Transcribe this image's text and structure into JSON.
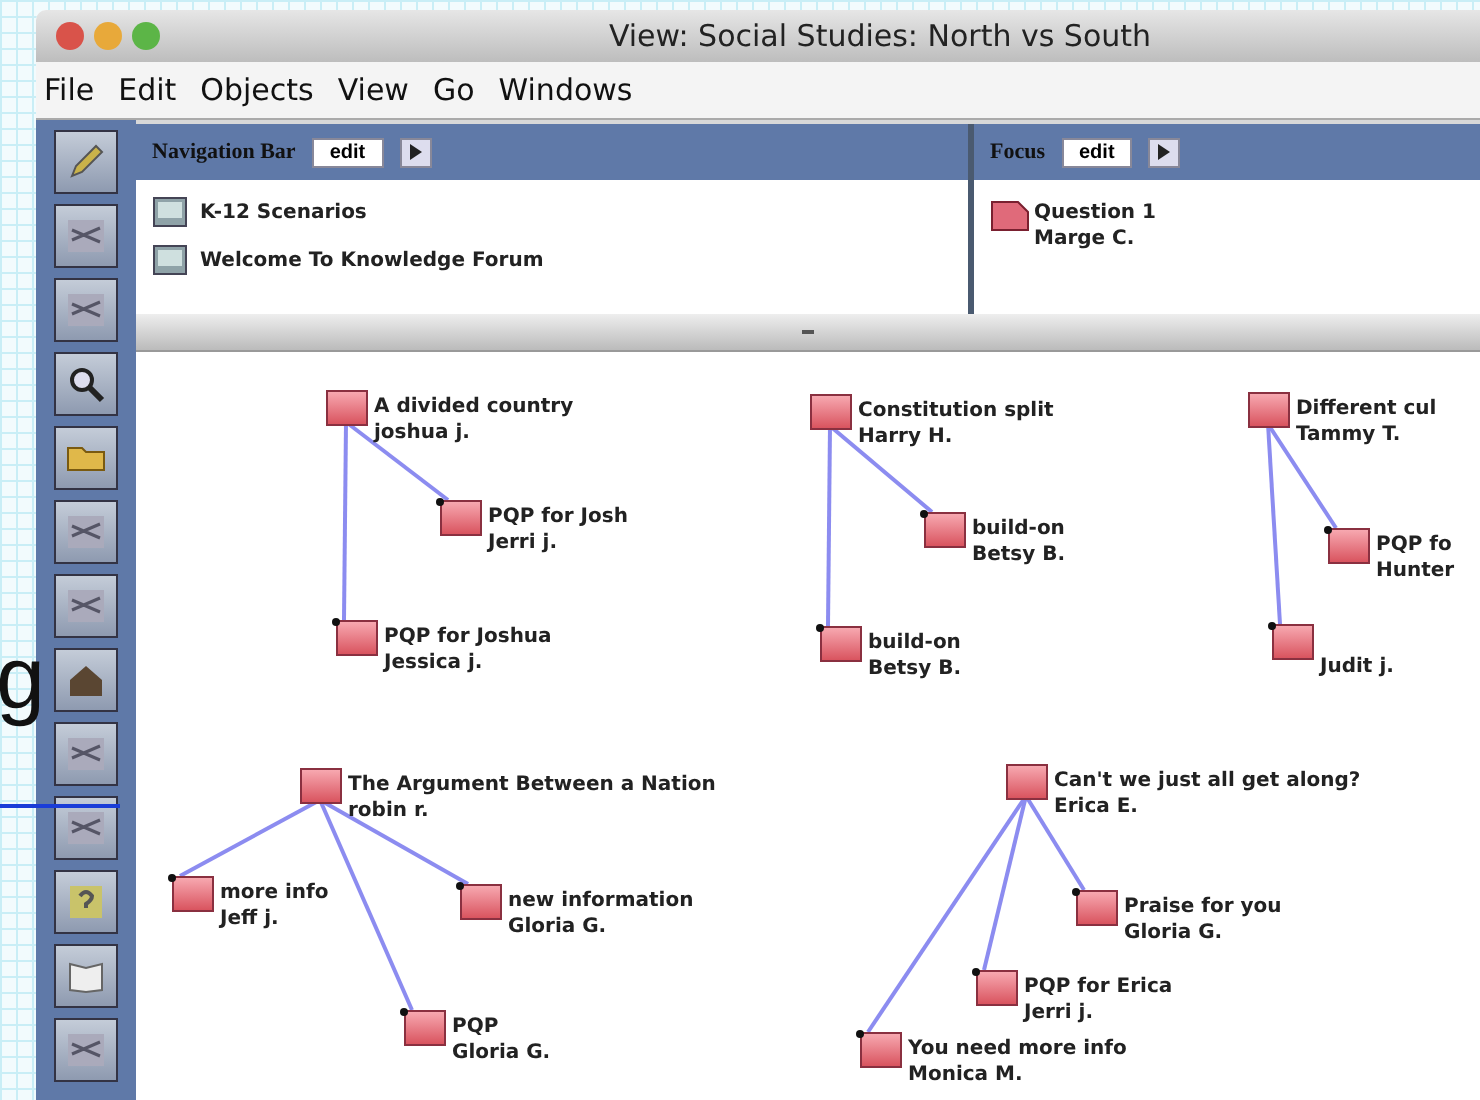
{
  "slide_text": "g",
  "window": {
    "title": "View: Social Studies: North vs South"
  },
  "menu": [
    "File",
    "Edit",
    "Objects",
    "View",
    "Go",
    "Windows"
  ],
  "navigation_bar": {
    "title": "Navigation Bar",
    "mode": "edit",
    "items": [
      "K-12 Scenarios",
      "Welcome To Knowledge Forum"
    ]
  },
  "focus": {
    "title": "Focus",
    "mode": "edit",
    "note": {
      "title": "Question 1",
      "author": "Marge C."
    }
  },
  "clusters": [
    {
      "title": "A divided country",
      "author": "joshua j.",
      "children": [
        {
          "title": "PQP for Josh",
          "author": "Jerri j."
        },
        {
          "title": "PQP for Joshua",
          "author": "Jessica j."
        }
      ]
    },
    {
      "title": "Constitution split",
      "author": "Harry H.",
      "children": [
        {
          "title": "build-on",
          "author": "Betsy B."
        },
        {
          "title": "build-on",
          "author": "Betsy B."
        }
      ]
    },
    {
      "title": "Different cul",
      "author": "Tammy T.",
      "children": [
        {
          "title": "PQP fo",
          "author": "Hunter"
        },
        {
          "author": "Judit j."
        }
      ]
    },
    {
      "title": "The Argument Between a Nation",
      "author": "robin r.",
      "children": [
        {
          "title": "more info",
          "author": "Jeff j."
        },
        {
          "title": "new information",
          "author": "Gloria G."
        },
        {
          "title": "PQP",
          "author": "Gloria G."
        }
      ]
    },
    {
      "title": "Can't we just all get along?",
      "author": "Erica E.",
      "children": [
        {
          "title": "Praise for you",
          "author": "Gloria G."
        },
        {
          "title": "PQP for Erica",
          "author": "Jerri j."
        },
        {
          "title": "You need more info",
          "author": "Monica M."
        }
      ]
    }
  ]
}
